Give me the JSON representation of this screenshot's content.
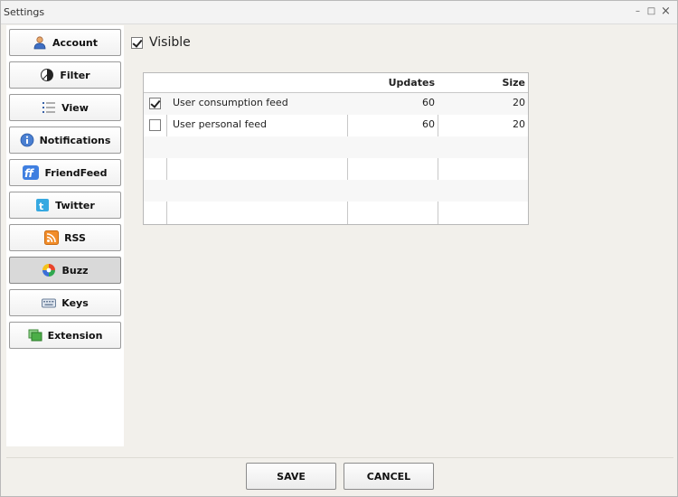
{
  "window": {
    "title": "Settings",
    "minimize_label": "–",
    "maximize_label": "□",
    "close_label": "×"
  },
  "sidebar": {
    "items": [
      {
        "label": "Account",
        "icon": "user-icon",
        "active": false
      },
      {
        "label": "Filter",
        "icon": "filter-icon",
        "active": false
      },
      {
        "label": "View",
        "icon": "list-icon",
        "active": false
      },
      {
        "label": "Notifications",
        "icon": "info-icon",
        "active": false
      },
      {
        "label": "FriendFeed",
        "icon": "friendfeed-icon",
        "active": false
      },
      {
        "label": "Twitter",
        "icon": "twitter-icon",
        "active": false
      },
      {
        "label": "RSS",
        "icon": "rss-icon",
        "active": false
      },
      {
        "label": "Buzz",
        "icon": "buzz-icon",
        "active": true
      },
      {
        "label": "Keys",
        "icon": "keyboard-icon",
        "active": false
      },
      {
        "label": "Extension",
        "icon": "extension-icon",
        "active": false
      }
    ]
  },
  "main": {
    "visible": {
      "label": "Visible",
      "checked": true
    },
    "table": {
      "columns": [
        "",
        "",
        "Updates",
        "Size"
      ],
      "rows": [
        {
          "checked": true,
          "name": "User consumption feed",
          "updates": "60",
          "size": "20"
        },
        {
          "checked": false,
          "name": "User personal feed",
          "updates": "60",
          "size": "20"
        }
      ]
    }
  },
  "footer": {
    "save_label": "SAVE",
    "cancel_label": "CANCEL"
  }
}
